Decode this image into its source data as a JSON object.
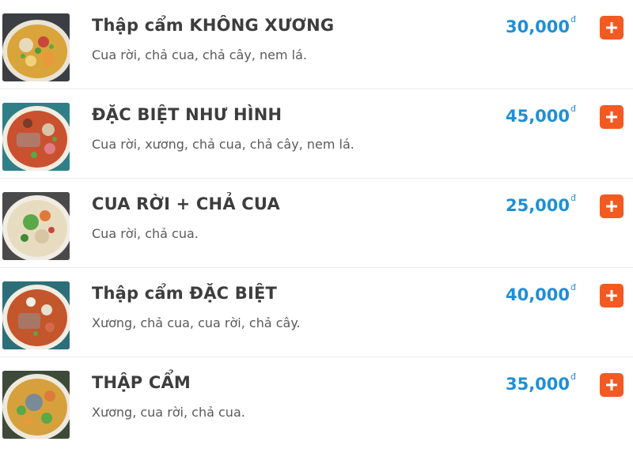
{
  "currency_symbol": "đ",
  "colors": {
    "price": "#1f8fd6",
    "add_button": "#f25a22",
    "title": "#3d3d3d",
    "description": "#5a5a5a"
  },
  "items": [
    {
      "name": "Thập cẩm KHÔNG XƯƠNG",
      "description": "Cua rời, chả cua, chả cây, nem lá.",
      "price": "30,000",
      "image_icon": "noodle-soup-photo",
      "add_icon": "plus-icon"
    },
    {
      "name": "ĐẶC BIỆT NHƯ HÌNH",
      "description": "Cua rời, xương, chả cua, chả cây, nem lá.",
      "price": "45,000",
      "image_icon": "noodle-soup-photo",
      "add_icon": "plus-icon"
    },
    {
      "name": "CUA RỜI + CHẢ CUA",
      "description": "Cua rời, chả cua.",
      "price": "25,000",
      "image_icon": "noodle-soup-photo",
      "add_icon": "plus-icon"
    },
    {
      "name": "Thập cẩm ĐẶC BIỆT",
      "description": "Xương, chả cua, cua rời, chả cây.",
      "price": "40,000",
      "image_icon": "noodle-soup-photo",
      "add_icon": "plus-icon"
    },
    {
      "name": "THẬP CẨM",
      "description": "Xương, cua rời, chả cua.",
      "price": "35,000",
      "image_icon": "noodle-soup-photo",
      "add_icon": "plus-icon"
    }
  ]
}
